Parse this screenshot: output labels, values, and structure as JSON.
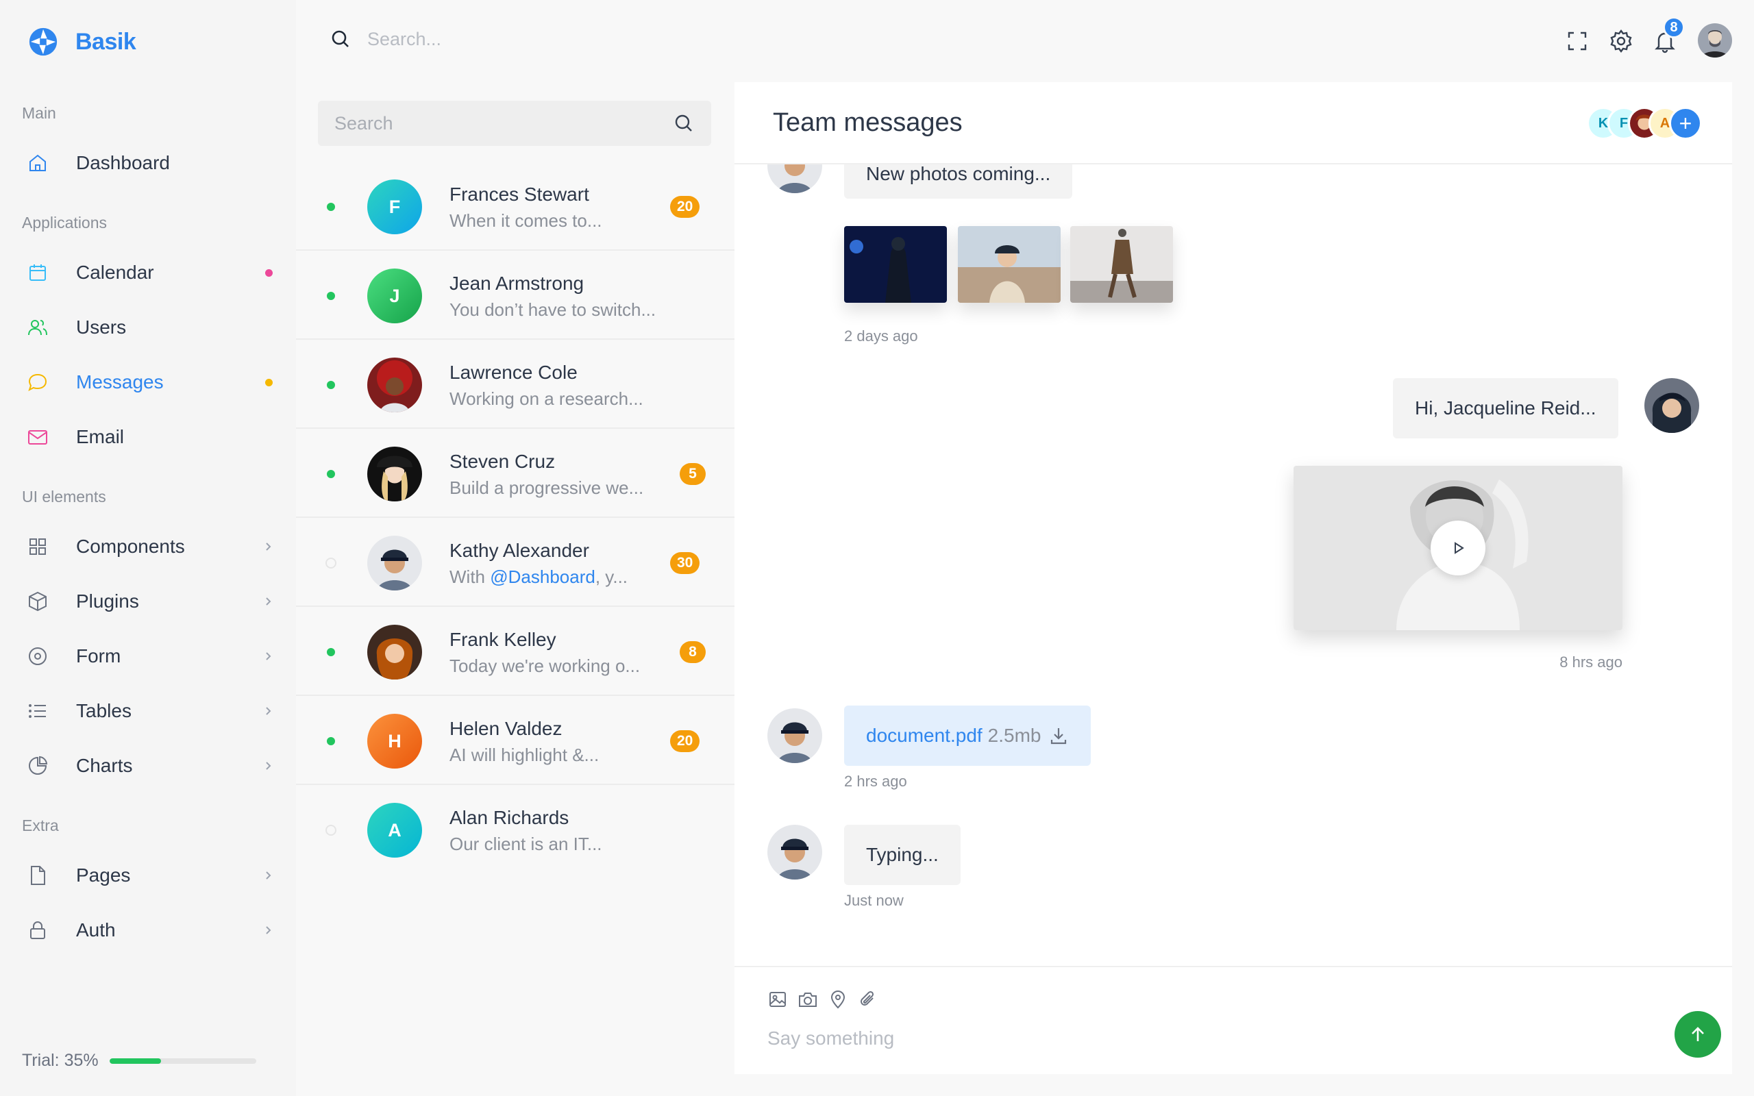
{
  "app": {
    "name": "Basik",
    "brand_color": "#2f86ee"
  },
  "topbar": {
    "search_placeholder": "Search...",
    "notification_count": "8",
    "icons": [
      "fullscreen-icon",
      "gear-icon",
      "bell-icon"
    ]
  },
  "sidebar": {
    "sections": {
      "main": "Main",
      "applications": "Applications",
      "ui_elements": "UI elements",
      "extra": "Extra"
    },
    "items": [
      {
        "label": "Dashboard",
        "icon": "home-icon"
      },
      {
        "label": "Calendar",
        "icon": "calendar-icon",
        "dot": "#ec4899"
      },
      {
        "label": "Users",
        "icon": "users-icon"
      },
      {
        "label": "Messages",
        "icon": "message-icon",
        "dot": "#f5b800",
        "active": true
      },
      {
        "label": "Email",
        "icon": "mail-icon"
      },
      {
        "label": "Components",
        "icon": "grid-icon"
      },
      {
        "label": "Plugins",
        "icon": "box-icon"
      },
      {
        "label": "Form",
        "icon": "target-icon"
      },
      {
        "label": "Tables",
        "icon": "list-icon"
      },
      {
        "label": "Charts",
        "icon": "pie-chart-icon"
      },
      {
        "label": "Pages",
        "icon": "file-icon"
      },
      {
        "label": "Auth",
        "icon": "lock-icon"
      }
    ],
    "trial": {
      "label": "Trial: 35%",
      "progress": 0.35
    }
  },
  "conversations": {
    "search_placeholder": "Search",
    "items": [
      {
        "name": "Frances Stewart",
        "preview": "When it comes to...",
        "initial": "F",
        "badge": "20",
        "online": true
      },
      {
        "name": "Jean Armstrong",
        "preview": "You don’t have to switch...",
        "initial": "J",
        "badge": "",
        "online": true
      },
      {
        "name": "Lawrence Cole",
        "preview": "Working on a research...",
        "initial": "",
        "badge": "",
        "online": true
      },
      {
        "name": "Steven Cruz",
        "preview": "Build a progressive we...",
        "initial": "",
        "badge": "5",
        "online": true
      },
      {
        "name": "Kathy Alexander",
        "preview_prefix": "With ",
        "preview_mention": "@Dashboard",
        "preview_suffix": ", y...",
        "initial": "",
        "badge": "30",
        "online": false
      },
      {
        "name": "Frank Kelley",
        "preview": "Today we're working o...",
        "initial": "",
        "badge": "8",
        "online": true
      },
      {
        "name": "Helen Valdez",
        "preview": "AI will highlight &...",
        "initial": "H",
        "badge": "20",
        "online": true
      },
      {
        "name": "Alan Richards",
        "preview": "Our client is an IT...",
        "initial": "A",
        "badge": "",
        "online": false
      }
    ]
  },
  "chat": {
    "title": "Team messages",
    "members": [
      "K",
      "F",
      "",
      "A"
    ],
    "messages": {
      "photos_text": "New photos coming...",
      "photos_time": "2 days ago",
      "greeting_text": "Hi, Jacqueline Reid...",
      "video_time": "8 hrs ago",
      "file_name": "document.pdf",
      "file_size": "2.5mb",
      "file_time": "2 hrs ago",
      "typing_text": "Typing...",
      "typing_time": "Just now"
    },
    "composer_placeholder": "Say something"
  }
}
